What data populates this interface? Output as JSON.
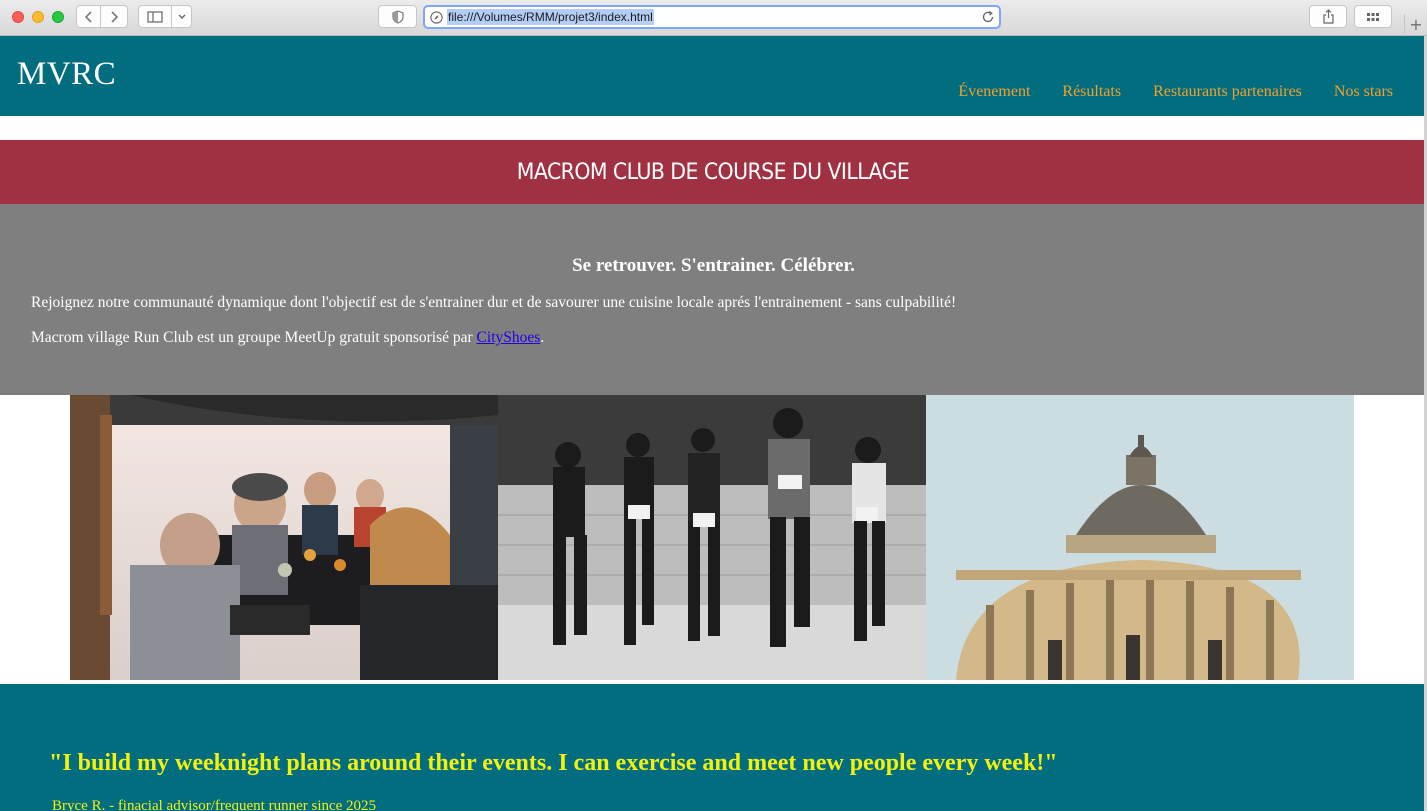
{
  "browser": {
    "url": "file:///Volumes/RMM/projet3/index.html",
    "new_tab_label": "+"
  },
  "header": {
    "logo": "MVRC",
    "nav": [
      "Évenement",
      "Résultats",
      "Restaurants partenaires",
      "Nos stars"
    ]
  },
  "banner": {
    "title": "MACROM CLUB DE COURSE DU VILLAGE"
  },
  "intro": {
    "heading": "Se retrouver. S'entrainer. Célébrer.",
    "paragraph1": "Rejoignez notre communauté dynamique dont l'objectif est de s'entrainer dur et de savourer une cuisine locale aprés l'entrainement - sans culpabilité!",
    "paragraph2_prefix": "Macrom village Run Club est un groupe MeetUp gratuit sponsorisé par ",
    "paragraph2_link": "CityShoes",
    "paragraph2_suffix": "."
  },
  "photos": [
    {
      "name": "restaurant-photo"
    },
    {
      "name": "marathon-runners-photo"
    },
    {
      "name": "dome-building-photo"
    }
  ],
  "testimonial": {
    "quote": "\"I build my weeknight plans around their events. I can exercise and meet new people every week!\"",
    "attribution": "Bryce R. - finacial advisor/frequent runner since 2025"
  },
  "colors": {
    "header_bg": "#016d7e",
    "nav_link": "#f0a130",
    "banner_bg": "#a03142",
    "intro_bg": "#7f7f7f",
    "link": "#1f00e3",
    "testimonial_text": "#f2f20e"
  }
}
